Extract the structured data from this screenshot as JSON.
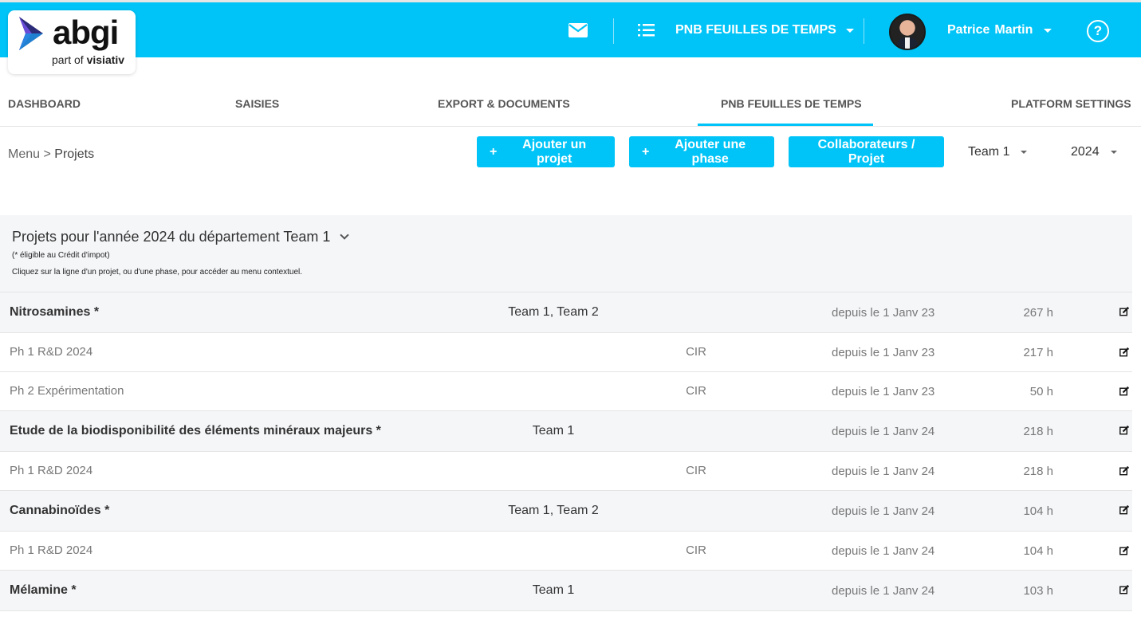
{
  "brand": {
    "logo_text": "abgi",
    "sub_prefix": "part of",
    "sub_brand": "visiativ"
  },
  "header": {
    "app_menu_label": "PNB FEUILLES DE TEMPS",
    "user_first": "Patrice",
    "user_last": "Martin",
    "help_label": "?"
  },
  "nav": {
    "tabs": [
      "DASHBOARD",
      "SAISIES",
      "EXPORT & DOCUMENTS",
      "PNB FEUILLES DE TEMPS",
      "PLATFORM SETTINGS"
    ],
    "active": "PNB FEUILLES DE TEMPS"
  },
  "toolbar": {
    "breadcrumb_root": "Menu",
    "breadcrumb_sep": ">",
    "breadcrumb_current": "Projets",
    "add_project": "Ajouter un projet",
    "add_phase": "Ajouter une phase",
    "collaborators": "Collaborateurs / Projet",
    "team_select": "Team 1",
    "year_select": "2024",
    "plus": "+"
  },
  "panel": {
    "title": "Projets pour l'année 2024 du département Team 1",
    "note1": "(* éligible au Crédit d'impot)",
    "note2": "Cliquez sur la ligne d'un projet, ou d'une phase, pour accéder au menu contextuel."
  },
  "rows": [
    {
      "kind": "project",
      "name": "Nitrosamines *",
      "team": "Team 1, Team 2",
      "type": "",
      "since": "depuis le 1 Janv 23",
      "hours": "267 h"
    },
    {
      "kind": "phase",
      "name": "Ph 1 R&D 2024",
      "team": "",
      "type": "CIR",
      "since": "depuis le 1 Janv 23",
      "hours": "217 h"
    },
    {
      "kind": "phase",
      "name": "Ph 2 Expérimentation",
      "team": "",
      "type": "CIR",
      "since": "depuis le 1 Janv 23",
      "hours": "50 h"
    },
    {
      "kind": "project",
      "name": "Etude de la biodisponibilité des éléments minéraux majeurs *",
      "team": "Team 1",
      "type": "",
      "since": "depuis le 1 Janv 24",
      "hours": "218 h"
    },
    {
      "kind": "phase",
      "name": "Ph 1 R&D 2024",
      "team": "",
      "type": "CIR",
      "since": "depuis le 1 Janv 24",
      "hours": "218 h"
    },
    {
      "kind": "project",
      "name": "Cannabinoïdes *",
      "team": "Team 1, Team 2",
      "type": "",
      "since": "depuis le 1 Janv 24",
      "hours": "104 h"
    },
    {
      "kind": "phase",
      "name": "Ph 1 R&D 2024",
      "team": "",
      "type": "CIR",
      "since": "depuis le 1 Janv 24",
      "hours": "104 h"
    },
    {
      "kind": "project",
      "name": "Mélamine *",
      "team": "Team 1",
      "type": "",
      "since": "depuis le 1 Janv 24",
      "hours": "103 h"
    }
  ],
  "icons": {
    "mail": "mail-icon",
    "list": "list-icon",
    "help": "help-icon",
    "edit": "edit-icon",
    "chevron": "chevron-down-icon"
  },
  "colors": {
    "accent": "#00c4f7",
    "brand_dark": "#2b2b7a",
    "brand_purple": "#6a4bd8"
  }
}
